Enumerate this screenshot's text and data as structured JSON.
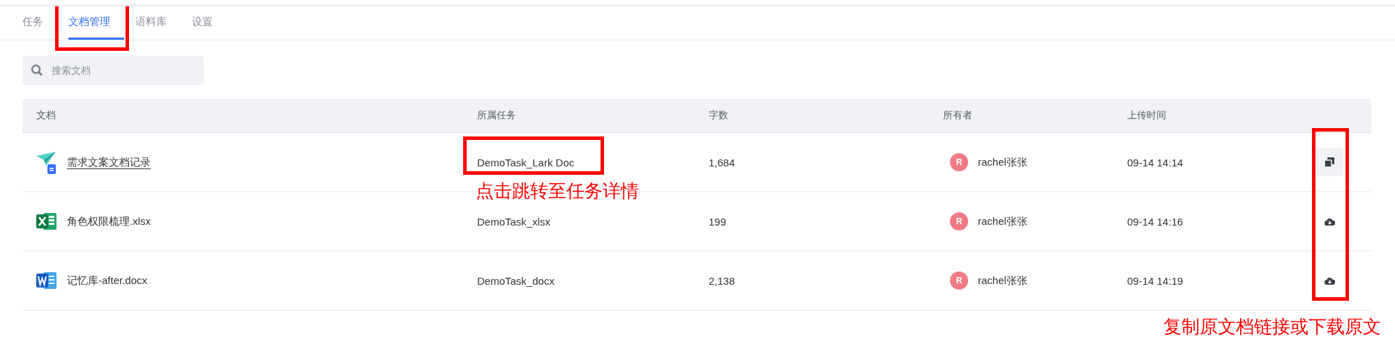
{
  "tabs": [
    {
      "label": "任务",
      "selected": false,
      "boxed": false
    },
    {
      "label": "文档管理",
      "selected": true,
      "boxed": true
    },
    {
      "label": "语料库",
      "selected": false,
      "boxed": false
    },
    {
      "label": "设置",
      "selected": false,
      "boxed": false
    }
  ],
  "search": {
    "placeholder": "搜索文档"
  },
  "table": {
    "columns": [
      "文档",
      "所属任务",
      "字数",
      "所有者",
      "上传时间"
    ],
    "rows": [
      {
        "doc": "需求文案文档记录",
        "kind": "lark",
        "link": true,
        "task": "DemoTask_Lark Doc",
        "task_boxed": true,
        "words": "1,684",
        "owner_initial": "R",
        "owner": "rachel张张",
        "uploaded": "09-14 14:14",
        "action": {
          "kind": "copy",
          "hovered": true
        }
      },
      {
        "doc": "角色权限梳理.xlsx",
        "kind": "excel",
        "link": false,
        "task": "DemoTask_xlsx",
        "task_boxed": false,
        "words": "199",
        "owner_initial": "R",
        "owner": "rachel张张",
        "uploaded": "09-14 14:16",
        "action": {
          "kind": "download",
          "hovered": false
        }
      },
      {
        "doc": "记忆库-after.docx",
        "kind": "word",
        "link": false,
        "task": "DemoTask_docx",
        "task_boxed": false,
        "words": "2,138",
        "owner_initial": "R",
        "owner": "rachel张张",
        "uploaded": "09-14 14:19",
        "action": {
          "kind": "download",
          "hovered": false
        }
      }
    ],
    "actions_boxed": true
  },
  "annotations": {
    "task_note": "点击跳转至任务详情",
    "actions_note": "复制原文档链接或下载原文"
  }
}
